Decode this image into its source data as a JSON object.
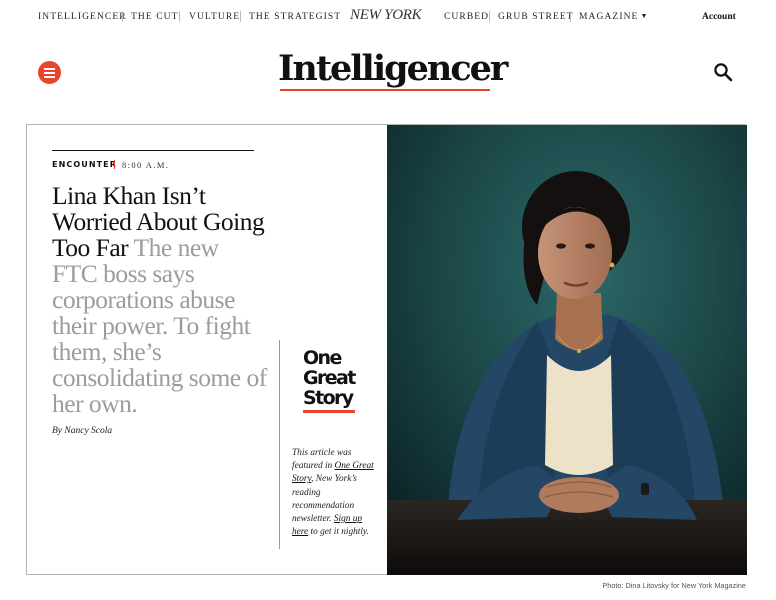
{
  "nav": {
    "links": [
      "INTELLIGENCER",
      "THE CUT",
      "VULTURE",
      "THE STRATEGIST",
      "CURBED",
      "GRUB STREET",
      "MAGAZINE"
    ],
    "logo": "NEW YORK",
    "account": "Account"
  },
  "header": {
    "title": "Intelligencer",
    "accent_color": "#e8452c"
  },
  "article": {
    "rubric": "ENCOUNTER",
    "time": "8:00 A.M.",
    "headline": "Lina Khan Isn’t Worried About Going Too Far",
    "dek": "The new FTC boss says corporations abuse their power. To fight them, she’s consolidating some of her own.",
    "byline": "By Nancy Scola"
  },
  "promo": {
    "title_lines": [
      "One",
      "Great",
      "Story"
    ],
    "note": {
      "part1": "This article was featured in ",
      "link1": "One Great Story",
      "part2": ", New York’s reading recommendation newsletter. ",
      "link2": "Sign up here",
      "part3": " to get it nightly."
    }
  },
  "photo": {
    "credit": "Photo: Dina Litovsky for New York Magazine"
  },
  "icons": [
    "menu-icon",
    "search-icon",
    "chevron-down-icon"
  ]
}
